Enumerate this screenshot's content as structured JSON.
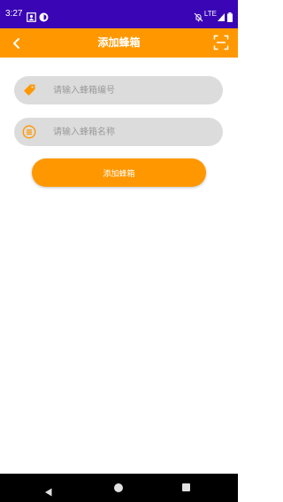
{
  "status_bar": {
    "time": "3:27",
    "network": "LTE",
    "left_icons": [
      "photo-icon",
      "vpn-circle-icon"
    ],
    "right_icons": [
      "mute-icon",
      "signal-icon",
      "battery-icon"
    ]
  },
  "app_bar": {
    "title": "添加蜂箱",
    "back_icon": "chevron-left-icon",
    "scan_icon": "scan-frame-icon",
    "color": "#ff9800"
  },
  "form": {
    "hive_number": {
      "icon": "tag-icon",
      "placeholder": "请输入蜂箱编号",
      "value": ""
    },
    "hive_name": {
      "icon": "list-circle-icon",
      "placeholder": "请输入蜂箱名称",
      "value": ""
    },
    "submit_label": "添加蜂箱"
  },
  "nav_bar": {
    "icons": [
      "back-triangle-icon",
      "home-circle-icon",
      "recents-square-icon"
    ]
  },
  "colors": {
    "status_bar": "#3a05b4",
    "accent": "#ff9800",
    "field_bg": "#dcdcdc"
  }
}
